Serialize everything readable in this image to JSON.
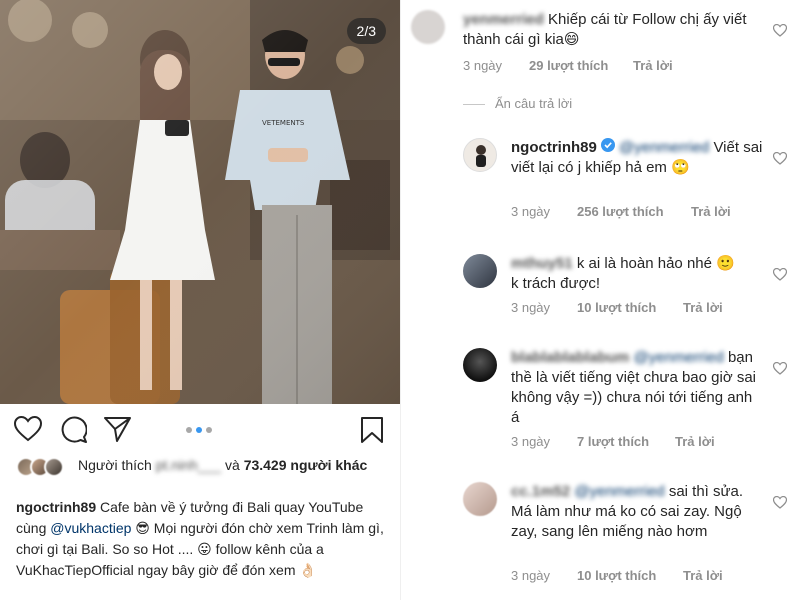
{
  "post": {
    "slide_counter": "2/3",
    "likes": {
      "prefix": "Người thích",
      "blurred_user": "pt.ninh___",
      "connector": "và",
      "count": "73.429",
      "suffix": "người khác"
    },
    "caption": {
      "username": "ngoctrinh89",
      "text_1": "Cafe bàn về ý tưởng đi Bali quay YouTube cùng",
      "mention": "@vukhactiep",
      "emoji_1": "😎",
      "text_2": "Mọi người đón chờ xem Trinh làm gì, chơi gì tại Bali. So so Hot ....",
      "emoji_2": "😛",
      "text_3": "follow kênh của a VuKhacTiepOfficial ngay bây giờ để đón xem",
      "emoji_3": "👌🏻"
    },
    "photo": {
      "shirt_text": "VETEMENTS"
    }
  },
  "comments": {
    "hide_replies": "Ẩn câu trả lời",
    "items": [
      {
        "username": "yenmerried",
        "mention": "",
        "text": "Khiếp cái từ Follow chị ấy viết thành cái gì kia",
        "emoji": "😄",
        "time": "3 ngày",
        "likes": "29 lượt thích",
        "reply": "Trả lời"
      },
      {
        "username": "ngoctrinh89",
        "mention": "@yenmerried",
        "text": "Viết sai viết lại có j khiếp hả em",
        "emoji": "🙄",
        "time": "3 ngày",
        "likes": "256 lượt thích",
        "reply": "Trả lời"
      },
      {
        "username": "mthuy51",
        "mention": "",
        "text": "k ai là hoàn hảo nhé",
        "emoji": "🙂",
        "text_b": "k trách được!",
        "time": "3 ngày",
        "likes": "10 lượt thích",
        "reply": "Trả lời"
      },
      {
        "username": "blablablablabum",
        "mention": "@yenmerried",
        "text": "bạn thề là viết tiếng việt chưa bao giờ sai không vậy =)) chưa nói tới tiếng anh á",
        "emoji": "",
        "time": "3 ngày",
        "likes": "7 lượt thích",
        "reply": "Trả lời"
      },
      {
        "username": "cc.1m52",
        "mention": "@yenmerried",
        "text": "sai thì sửa. Má làm như má ko có sai zay. Ngộ zay, sang lên miếng nào hơm",
        "emoji": "",
        "time": "3 ngày",
        "likes": "10 lượt thích",
        "reply": "Trả lời"
      }
    ]
  },
  "colors": {
    "text": "#262626",
    "muted": "#8e8e8e",
    "link": "#003569",
    "verified": "#3897f0",
    "dot_active": "#3897f0"
  },
  "icons": [
    "heart-icon",
    "comment-icon",
    "share-icon",
    "bookmark-icon",
    "verified-icon"
  ]
}
